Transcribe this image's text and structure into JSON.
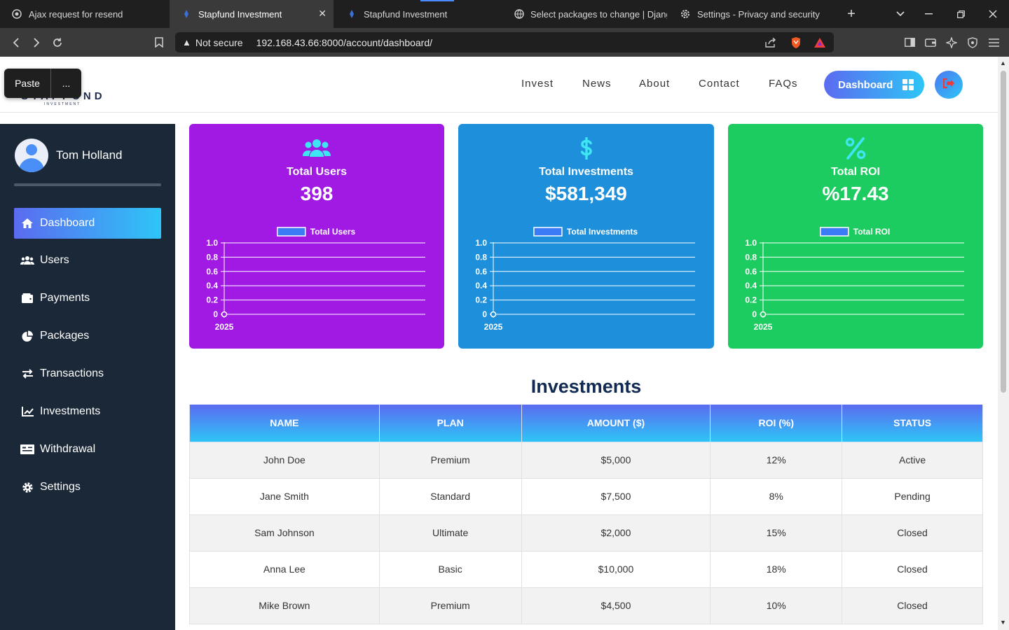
{
  "browser": {
    "tabs": [
      {
        "title": "Ajax request for resend"
      },
      {
        "title": "Stapfund Investment"
      },
      {
        "title": "Stapfund Investment"
      },
      {
        "title": "Select packages to change | Django"
      },
      {
        "title": "Settings - Privacy and security"
      }
    ],
    "security_label": "Not secure",
    "url": "192.168.43.66:8000/account/dashboard/"
  },
  "paste_popup": {
    "paste": "Paste",
    "more": "..."
  },
  "site": {
    "logo": "STAPFUND",
    "logo_sub": "INVESTMENT",
    "nav": [
      "Invest",
      "News",
      "About",
      "Contact",
      "FAQs"
    ],
    "dashboard_button": "Dashboard"
  },
  "sidebar": {
    "user_name": "Tom Holland",
    "items": [
      {
        "label": "Dashboard",
        "icon": "home-icon"
      },
      {
        "label": "Users",
        "icon": "users-icon"
      },
      {
        "label": "Payments",
        "icon": "wallet-icon"
      },
      {
        "label": "Packages",
        "icon": "pie-chart-icon"
      },
      {
        "label": "Transactions",
        "icon": "exchange-icon"
      },
      {
        "label": "Investments",
        "icon": "line-chart-icon"
      },
      {
        "label": "Withdrawal",
        "icon": "money-check-icon"
      },
      {
        "label": "Settings",
        "icon": "gear-icon"
      }
    ]
  },
  "cards": [
    {
      "title": "Total Users",
      "value": "398",
      "color": "#a01ae3",
      "icon": "users-icon"
    },
    {
      "title": "Total Investments",
      "value": "$581,349",
      "color": "#1e8fdb",
      "icon": "dollar-icon"
    },
    {
      "title": "Total ROI",
      "value": "%17.43",
      "color": "#1dcc60",
      "icon": "percent-icon"
    }
  ],
  "chart_data": [
    {
      "type": "line",
      "legend": "Total Users",
      "x": [
        "2025"
      ],
      "series": [
        {
          "name": "Total Users",
          "values": [
            0
          ]
        }
      ],
      "yticks": [
        "1.0",
        "0.8",
        "0.6",
        "0.4",
        "0.2",
        "0"
      ],
      "ylim": [
        0,
        1
      ],
      "grid": true,
      "legend_position": "top"
    },
    {
      "type": "line",
      "legend": "Total Investments",
      "x": [
        "2025"
      ],
      "series": [
        {
          "name": "Total Investments",
          "values": [
            0
          ]
        }
      ],
      "yticks": [
        "1.0",
        "0.8",
        "0.6",
        "0.4",
        "0.2",
        "0"
      ],
      "ylim": [
        0,
        1
      ],
      "grid": true,
      "legend_position": "top"
    },
    {
      "type": "line",
      "legend": "Total ROI",
      "x": [
        "2025"
      ],
      "series": [
        {
          "name": "Total ROI",
          "values": [
            0
          ]
        }
      ],
      "yticks": [
        "1.0",
        "0.8",
        "0.6",
        "0.4",
        "0.2",
        "0"
      ],
      "ylim": [
        0,
        1
      ],
      "grid": true,
      "legend_position": "top"
    }
  ],
  "investments": {
    "title": "Investments",
    "headers": [
      "NAME",
      "PLAN",
      "AMOUNT ($)",
      "ROI (%)",
      "STATUS"
    ],
    "rows": [
      [
        "John Doe",
        "Premium",
        "$5,000",
        "12%",
        "Active"
      ],
      [
        "Jane Smith",
        "Standard",
        "$7,500",
        "8%",
        "Pending"
      ],
      [
        "Sam Johnson",
        "Ultimate",
        "$2,000",
        "15%",
        "Closed"
      ],
      [
        "Anna Lee",
        "Basic",
        "$10,000",
        "18%",
        "Closed"
      ],
      [
        "Mike Brown",
        "Premium",
        "$4,500",
        "10%",
        "Closed"
      ]
    ]
  }
}
